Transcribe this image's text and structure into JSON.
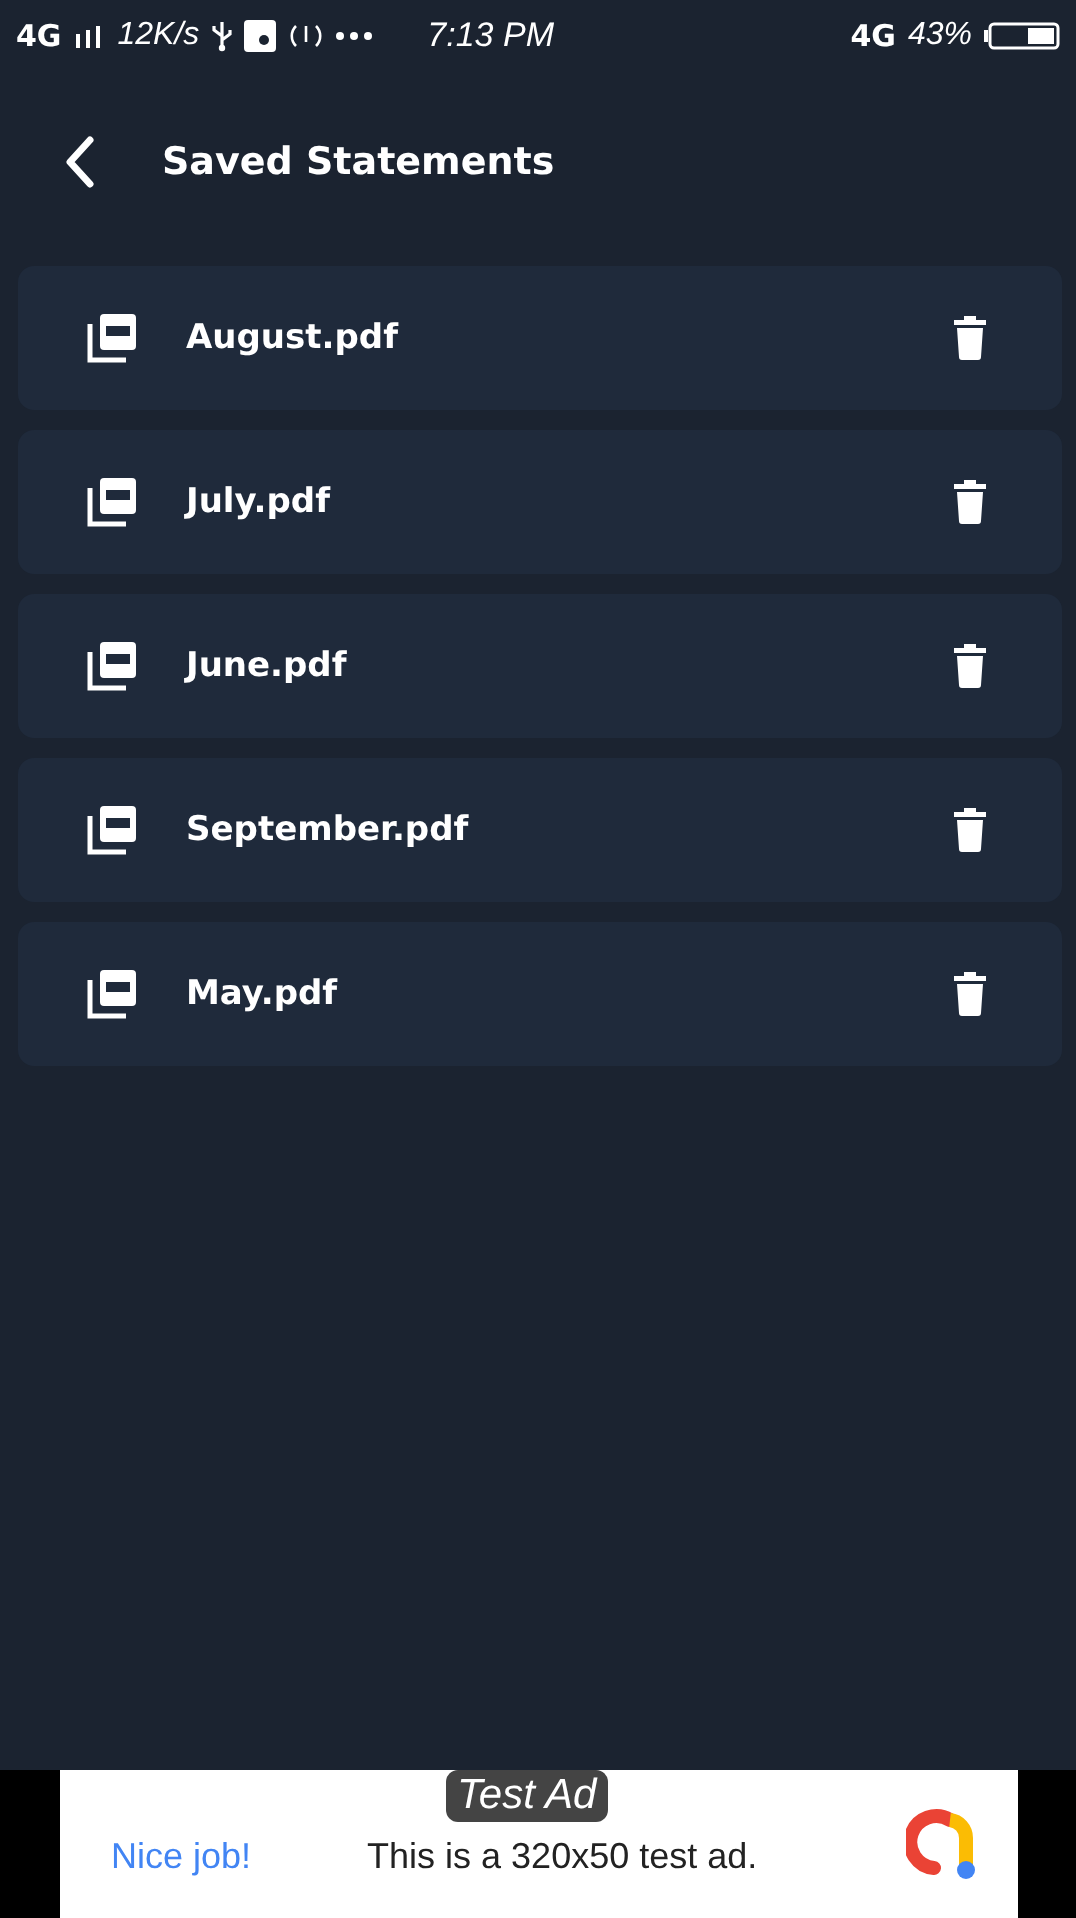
{
  "status_bar": {
    "network": "4G",
    "speed": "12K/s",
    "time": "7:13 PM",
    "network_right": "4G",
    "battery": "43%"
  },
  "header": {
    "title": "Saved Statements"
  },
  "files": [
    {
      "name": "August.pdf"
    },
    {
      "name": "July.pdf"
    },
    {
      "name": "June.pdf"
    },
    {
      "name": "September.pdf"
    },
    {
      "name": "May.pdf"
    }
  ],
  "ad": {
    "badge": "Test Ad",
    "headline": "Nice job!",
    "text": "This is a 320x50 test ad."
  }
}
